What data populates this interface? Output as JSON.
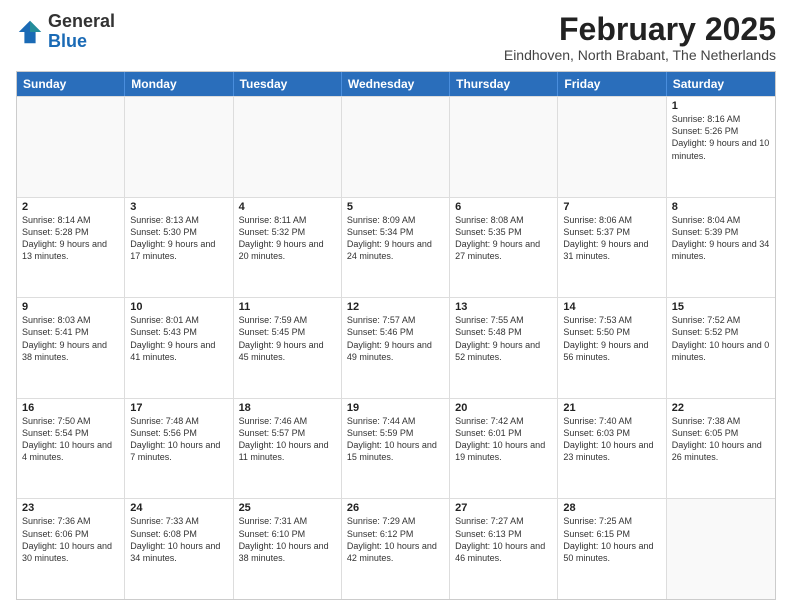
{
  "logo": {
    "general": "General",
    "blue": "Blue"
  },
  "title": "February 2025",
  "location": "Eindhoven, North Brabant, The Netherlands",
  "header_days": [
    "Sunday",
    "Monday",
    "Tuesday",
    "Wednesday",
    "Thursday",
    "Friday",
    "Saturday"
  ],
  "rows": [
    [
      {
        "day": "",
        "info": ""
      },
      {
        "day": "",
        "info": ""
      },
      {
        "day": "",
        "info": ""
      },
      {
        "day": "",
        "info": ""
      },
      {
        "day": "",
        "info": ""
      },
      {
        "day": "",
        "info": ""
      },
      {
        "day": "1",
        "info": "Sunrise: 8:16 AM\nSunset: 5:26 PM\nDaylight: 9 hours and 10 minutes."
      }
    ],
    [
      {
        "day": "2",
        "info": "Sunrise: 8:14 AM\nSunset: 5:28 PM\nDaylight: 9 hours and 13 minutes."
      },
      {
        "day": "3",
        "info": "Sunrise: 8:13 AM\nSunset: 5:30 PM\nDaylight: 9 hours and 17 minutes."
      },
      {
        "day": "4",
        "info": "Sunrise: 8:11 AM\nSunset: 5:32 PM\nDaylight: 9 hours and 20 minutes."
      },
      {
        "day": "5",
        "info": "Sunrise: 8:09 AM\nSunset: 5:34 PM\nDaylight: 9 hours and 24 minutes."
      },
      {
        "day": "6",
        "info": "Sunrise: 8:08 AM\nSunset: 5:35 PM\nDaylight: 9 hours and 27 minutes."
      },
      {
        "day": "7",
        "info": "Sunrise: 8:06 AM\nSunset: 5:37 PM\nDaylight: 9 hours and 31 minutes."
      },
      {
        "day": "8",
        "info": "Sunrise: 8:04 AM\nSunset: 5:39 PM\nDaylight: 9 hours and 34 minutes."
      }
    ],
    [
      {
        "day": "9",
        "info": "Sunrise: 8:03 AM\nSunset: 5:41 PM\nDaylight: 9 hours and 38 minutes."
      },
      {
        "day": "10",
        "info": "Sunrise: 8:01 AM\nSunset: 5:43 PM\nDaylight: 9 hours and 41 minutes."
      },
      {
        "day": "11",
        "info": "Sunrise: 7:59 AM\nSunset: 5:45 PM\nDaylight: 9 hours and 45 minutes."
      },
      {
        "day": "12",
        "info": "Sunrise: 7:57 AM\nSunset: 5:46 PM\nDaylight: 9 hours and 49 minutes."
      },
      {
        "day": "13",
        "info": "Sunrise: 7:55 AM\nSunset: 5:48 PM\nDaylight: 9 hours and 52 minutes."
      },
      {
        "day": "14",
        "info": "Sunrise: 7:53 AM\nSunset: 5:50 PM\nDaylight: 9 hours and 56 minutes."
      },
      {
        "day": "15",
        "info": "Sunrise: 7:52 AM\nSunset: 5:52 PM\nDaylight: 10 hours and 0 minutes."
      }
    ],
    [
      {
        "day": "16",
        "info": "Sunrise: 7:50 AM\nSunset: 5:54 PM\nDaylight: 10 hours and 4 minutes."
      },
      {
        "day": "17",
        "info": "Sunrise: 7:48 AM\nSunset: 5:56 PM\nDaylight: 10 hours and 7 minutes."
      },
      {
        "day": "18",
        "info": "Sunrise: 7:46 AM\nSunset: 5:57 PM\nDaylight: 10 hours and 11 minutes."
      },
      {
        "day": "19",
        "info": "Sunrise: 7:44 AM\nSunset: 5:59 PM\nDaylight: 10 hours and 15 minutes."
      },
      {
        "day": "20",
        "info": "Sunrise: 7:42 AM\nSunset: 6:01 PM\nDaylight: 10 hours and 19 minutes."
      },
      {
        "day": "21",
        "info": "Sunrise: 7:40 AM\nSunset: 6:03 PM\nDaylight: 10 hours and 23 minutes."
      },
      {
        "day": "22",
        "info": "Sunrise: 7:38 AM\nSunset: 6:05 PM\nDaylight: 10 hours and 26 minutes."
      }
    ],
    [
      {
        "day": "23",
        "info": "Sunrise: 7:36 AM\nSunset: 6:06 PM\nDaylight: 10 hours and 30 minutes."
      },
      {
        "day": "24",
        "info": "Sunrise: 7:33 AM\nSunset: 6:08 PM\nDaylight: 10 hours and 34 minutes."
      },
      {
        "day": "25",
        "info": "Sunrise: 7:31 AM\nSunset: 6:10 PM\nDaylight: 10 hours and 38 minutes."
      },
      {
        "day": "26",
        "info": "Sunrise: 7:29 AM\nSunset: 6:12 PM\nDaylight: 10 hours and 42 minutes."
      },
      {
        "day": "27",
        "info": "Sunrise: 7:27 AM\nSunset: 6:13 PM\nDaylight: 10 hours and 46 minutes."
      },
      {
        "day": "28",
        "info": "Sunrise: 7:25 AM\nSunset: 6:15 PM\nDaylight: 10 hours and 50 minutes."
      },
      {
        "day": "",
        "info": ""
      }
    ]
  ]
}
